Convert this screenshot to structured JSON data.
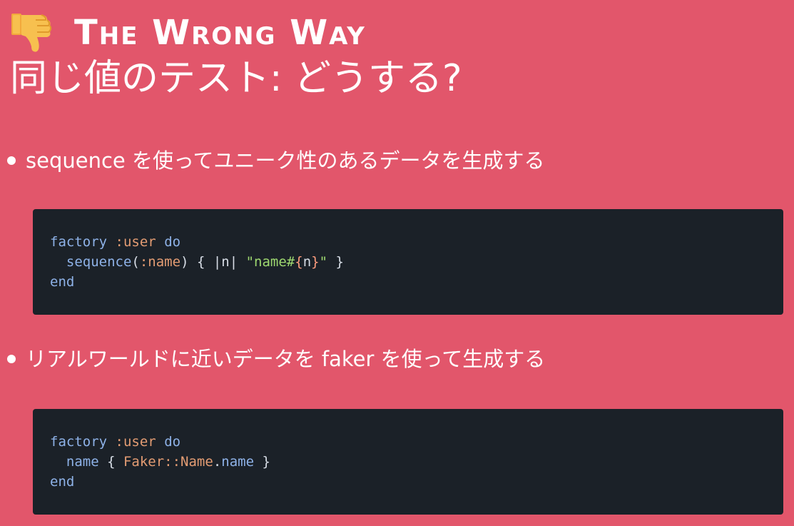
{
  "header": {
    "thumb_icon": "thumbs-down-icon",
    "wrong_way_label": "The Wrong Way",
    "title": "同じ値のテスト: どうする?"
  },
  "bullets": [
    {
      "text": "sequence を使ってユニーク性のあるデータを生成する",
      "code": {
        "line1": {
          "keyword": "factory",
          "symbol": ":user",
          "kw_do": "do"
        },
        "line2": {
          "indent": "  ",
          "method": "sequence",
          "open_paren": "(",
          "symbol": ":name",
          "close_paren": ")",
          "brace_open": " { ",
          "block_param": "|n|",
          "string_open": " \"name#",
          "interp_open": "{",
          "interp_var": "n",
          "interp_close": "}",
          "string_close": "\"",
          "brace_close": " }"
        },
        "line3": {
          "keyword": "end"
        }
      }
    },
    {
      "text": "リアルワールドに近いデータを faker を使って生成する",
      "code": {
        "line1": {
          "keyword": "factory",
          "symbol": ":user",
          "kw_do": "do"
        },
        "line2": {
          "indent": "  ",
          "method": "name",
          "brace_open": " { ",
          "constant": "Faker::Name",
          "dot": ".",
          "call": "name",
          "brace_close": " }"
        },
        "line3": {
          "keyword": "end"
        }
      }
    }
  ],
  "colors": {
    "background": "#e2566b",
    "code_background": "#1b2128",
    "keyword": "#8eb2e8",
    "symbol": "#e39c73",
    "string": "#9ed870",
    "interpolation": "#ff9d7e",
    "plain": "#d7dde6"
  }
}
